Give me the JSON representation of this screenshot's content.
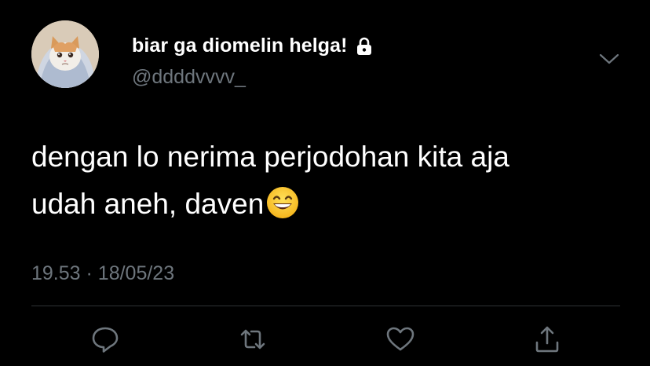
{
  "tweet": {
    "author": {
      "display_name": "biar ga diomelin helga!",
      "handle": "@ddddvvvv_",
      "protected_icon": "lock-icon"
    },
    "text_lines": [
      "dengan lo nerima perjodohan kita aja",
      "udah aneh, daven"
    ],
    "emoji": "grinning-face-with-smiling-eyes",
    "time": "19.53",
    "separator": "·",
    "date": "18/05/23"
  },
  "actions": [
    {
      "icon": "reply-icon"
    },
    {
      "icon": "retweet-icon"
    },
    {
      "icon": "like-icon"
    },
    {
      "icon": "share-icon"
    }
  ],
  "colors": {
    "background": "#000000",
    "text": "#ffffff",
    "secondary": "#6e767d",
    "divider": "#2f3336"
  }
}
